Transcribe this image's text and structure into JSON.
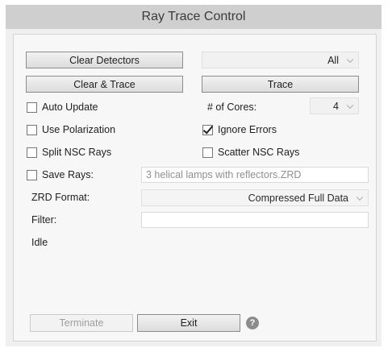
{
  "window": {
    "title": "Ray Trace Control"
  },
  "buttons": {
    "clear_detectors": "Clear Detectors",
    "clear_and_trace": "Clear & Trace",
    "trace": "Trace",
    "terminate": "Terminate",
    "exit": "Exit"
  },
  "detectors_dropdown": {
    "selected": "All"
  },
  "cores": {
    "label": "# of Cores:",
    "selected": "4"
  },
  "checkboxes": {
    "auto_update": {
      "label": "Auto Update",
      "checked": false
    },
    "use_polarization": {
      "label": "Use Polarization",
      "checked": false
    },
    "ignore_errors": {
      "label": "Ignore Errors",
      "checked": true
    },
    "split_nsc_rays": {
      "label": "Split NSC Rays",
      "checked": false
    },
    "scatter_nsc_rays": {
      "label": "Scatter NSC Rays",
      "checked": false
    },
    "save_rays": {
      "label": "Save Rays:",
      "checked": false
    }
  },
  "save_rays_file": {
    "value": "3 helical lamps with reflectors.ZRD"
  },
  "zrd_format": {
    "label": "ZRD Format:",
    "selected": "Compressed Full Data"
  },
  "filter": {
    "label": "Filter:",
    "value": ""
  },
  "status": {
    "text": "Idle"
  },
  "help": {
    "icon": "help-icon",
    "glyph": "?"
  }
}
